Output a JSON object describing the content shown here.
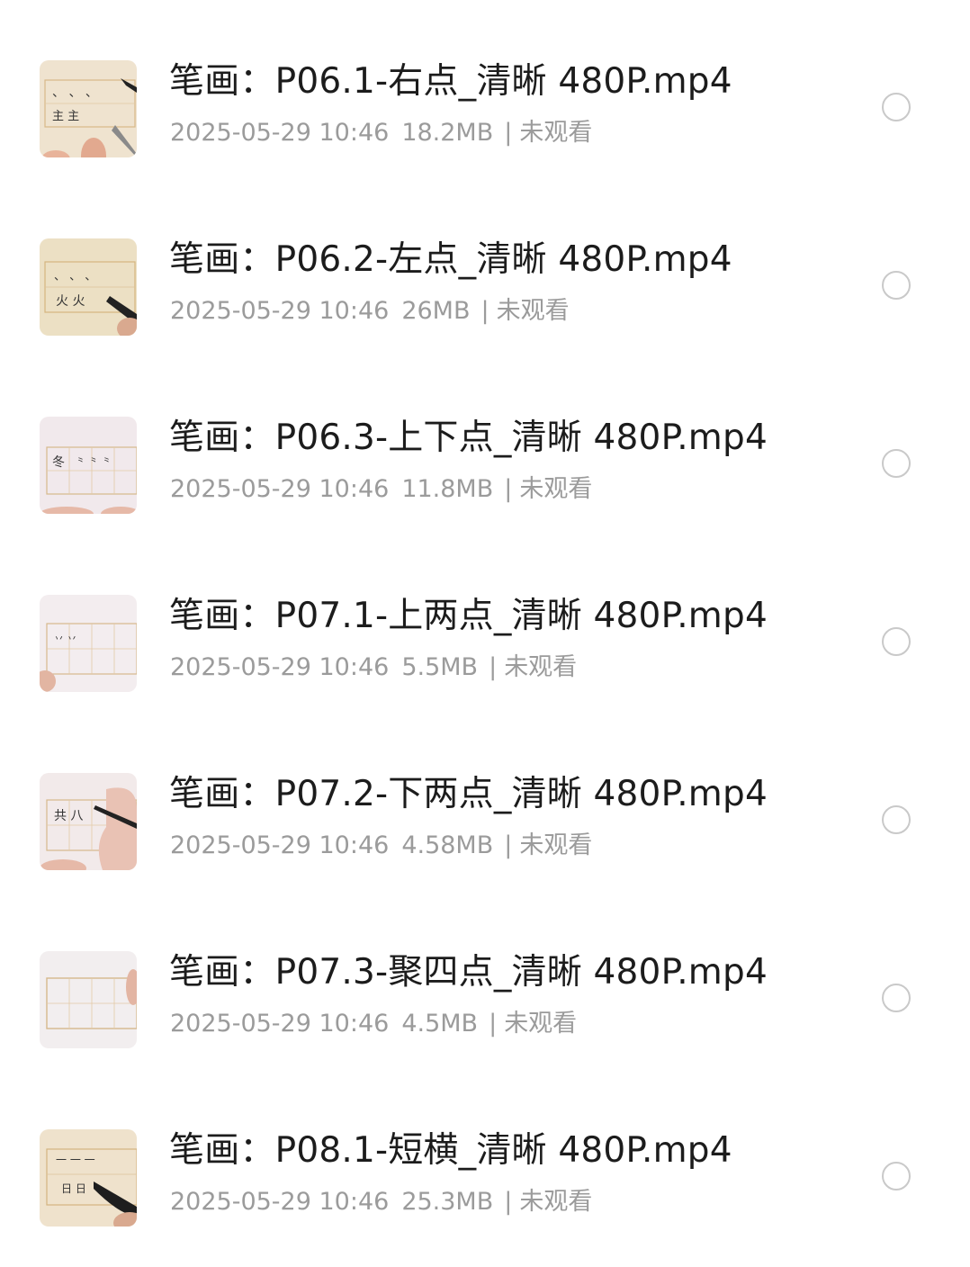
{
  "files": [
    {
      "title": "笔画：P06.1-右点_清晰 480P.mp4",
      "date": "2025-05-29 10:46",
      "size": "18.2MB",
      "status": "未观看",
      "thumb_chars": "主 主",
      "thumb_bg": "#efe3cf",
      "thumb_marks": "、 、 、"
    },
    {
      "title": "笔画：P06.2-左点_清晰 480P.mp4",
      "date": "2025-05-29 10:46",
      "size": "26MB",
      "status": "未观看",
      "thumb_chars": "火 火",
      "thumb_bg": "#ece0c4",
      "thumb_marks": "、 、 、"
    },
    {
      "title": "笔画：P06.3-上下点_清晰 480P.mp4",
      "date": "2025-05-29 10:46",
      "size": "11.8MB",
      "status": "未观看",
      "thumb_chars": "冬",
      "thumb_bg": "#f1e9ec",
      "thumb_marks": "⺀ ⺀ ⺀"
    },
    {
      "title": "笔画：P07.1-上两点_清晰 480P.mp4",
      "date": "2025-05-29 10:46",
      "size": "5.5MB",
      "status": "未观看",
      "thumb_chars": "丷 丷",
      "thumb_bg": "#f3edef",
      "thumb_marks": ""
    },
    {
      "title": "笔画：P07.2-下两点_清晰 480P.mp4",
      "date": "2025-05-29 10:46",
      "size": "4.58MB",
      "status": "未观看",
      "thumb_chars": "共 八",
      "thumb_bg": "#f2eaea",
      "thumb_marks": ""
    },
    {
      "title": "笔画：P07.3-聚四点_清晰 480P.mp4",
      "date": "2025-05-29 10:46",
      "size": "4.5MB",
      "status": "未观看",
      "thumb_chars": "",
      "thumb_bg": "#f2eeef",
      "thumb_marks": ""
    },
    {
      "title": "笔画：P08.1-短横_清晰 480P.mp4",
      "date": "2025-05-29 10:46",
      "size": "25.3MB",
      "status": "未观看",
      "thumb_chars": "日 日",
      "thumb_bg": "#efe2cc",
      "thumb_marks": "一 一 一"
    }
  ]
}
